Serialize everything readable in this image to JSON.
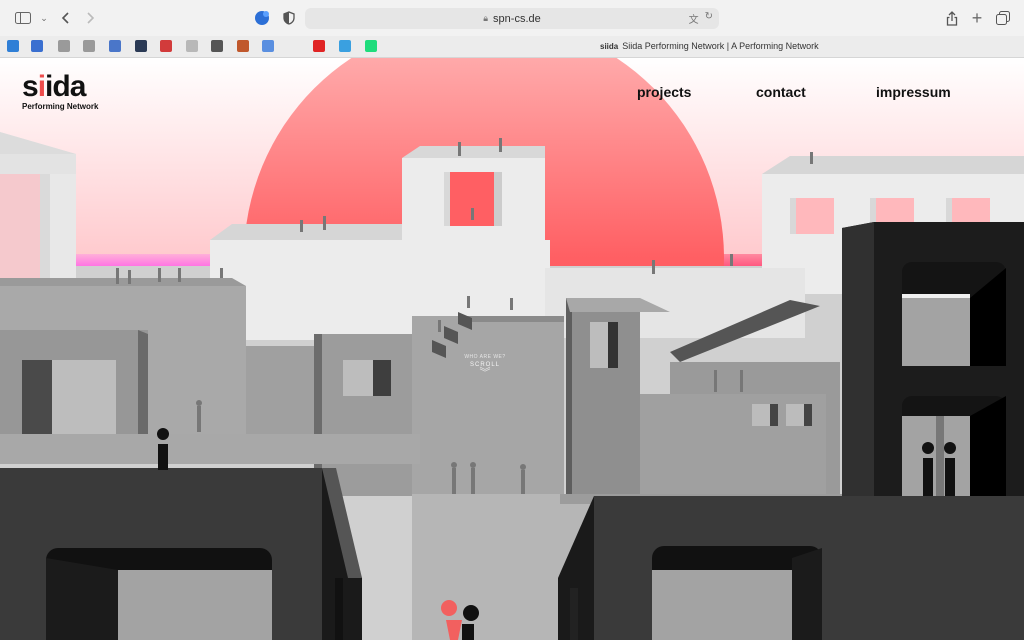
{
  "browser": {
    "url": "spn-cs.de",
    "tab_title": "Siida Performing Network | A Performing Network",
    "tab_favicon_text": "siida",
    "bookmark_colors": [
      "#2f7fd6",
      "#3a6fd0",
      "#9a9a9a",
      "#9a9a9a",
      "#4a76c9",
      "#2b3a55",
      "#d23b3b",
      "#b8b8b8",
      "#555555",
      "#c0582c",
      "#5a8fe0",
      "#e02424",
      "#3aa0e0",
      "#1fdc7c"
    ]
  },
  "site": {
    "logo_word_pre": "s",
    "logo_word_i": "i",
    "logo_word_post": "ida",
    "logo_tagline": "Performing Network",
    "nav": {
      "projects": "projects",
      "contact": "contact",
      "impressum": "impressum"
    },
    "scroll": {
      "small_label": "WHO ARE WE?",
      "label": "SCROLL",
      "chevron": "︾"
    }
  },
  "colors": {
    "sun": "#ff4f5a",
    "sky_top": "#ffffff",
    "sky_bottom": "#ffb3b8",
    "magenta": "#ff3cf5",
    "accent_red": "#f2605f"
  }
}
